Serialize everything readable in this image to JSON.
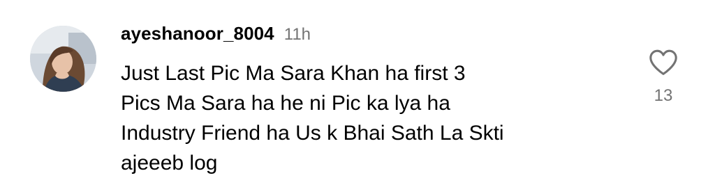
{
  "comment": {
    "username": "ayeshanoor_8004",
    "timestamp": "11h",
    "text": "Just Last Pic Ma Sara Khan ha first 3\nPics Ma Sara ha he ni Pic ka lya ha\nIndustry Friend ha Us k Bhai Sath La Skti\najeeeb log",
    "like_icon": "heart-outline-icon",
    "like_count": "13"
  },
  "colors": {
    "text": "#000000",
    "secondary_text": "#737373",
    "background": "#ffffff"
  }
}
